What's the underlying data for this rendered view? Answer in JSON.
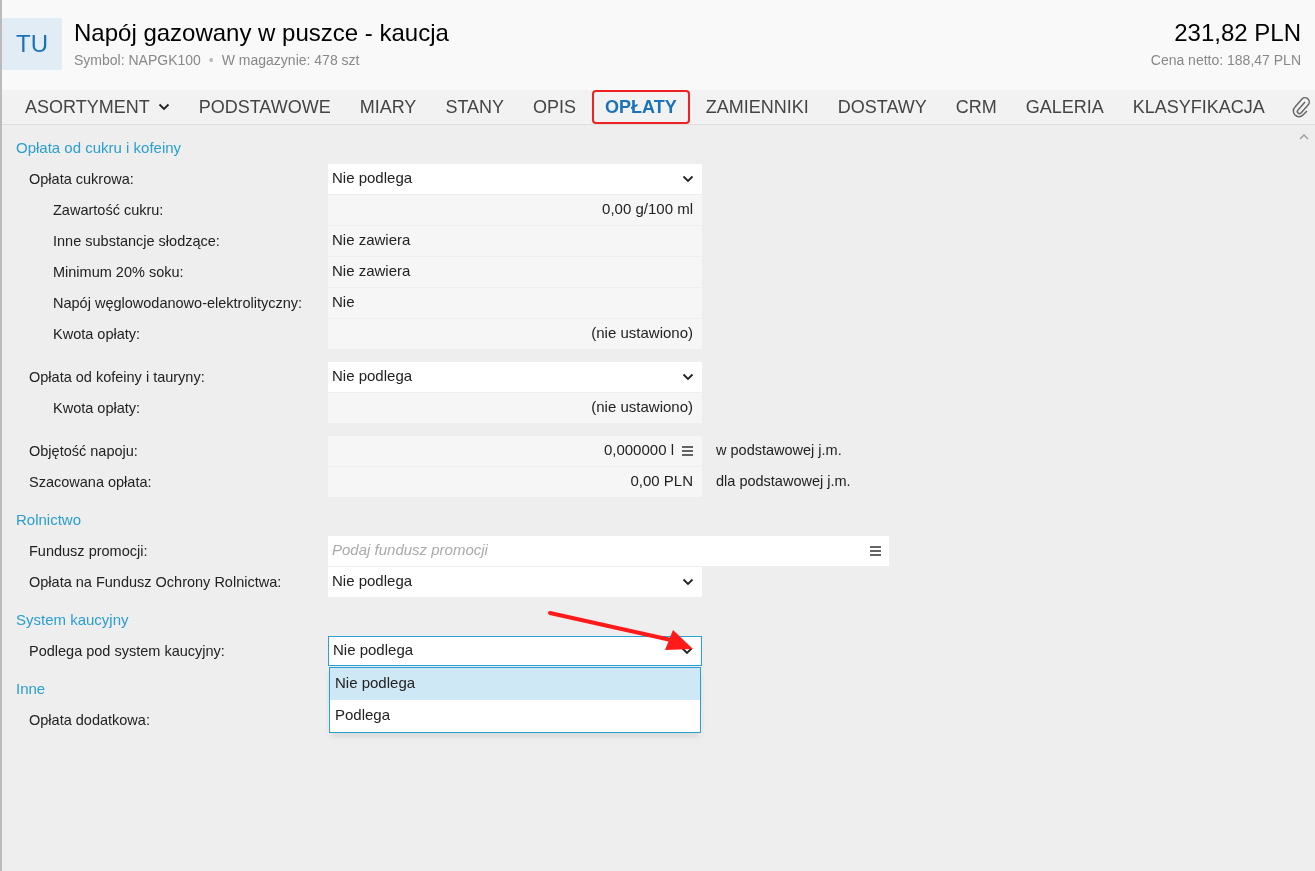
{
  "header": {
    "avatar": "TU",
    "title": "Napój gazowany w puszce - kaucja",
    "symbol": "Symbol: NAPGK100",
    "separator": "•",
    "stock": "W magazynie: 478 szt",
    "price": "231,82 PLN",
    "net_price": "Cena netto: 188,47 PLN"
  },
  "tabs": [
    {
      "label": "ASORTYMENT",
      "selected": false,
      "dropdown": true,
      "highlighted": false
    },
    {
      "label": "PODSTAWOWE",
      "selected": false,
      "dropdown": false,
      "highlighted": false
    },
    {
      "label": "MIARY",
      "selected": false,
      "dropdown": false,
      "highlighted": false
    },
    {
      "label": "STANY",
      "selected": false,
      "dropdown": false,
      "highlighted": false
    },
    {
      "label": "OPIS",
      "selected": false,
      "dropdown": false,
      "highlighted": false
    },
    {
      "label": "OPŁATY",
      "selected": true,
      "dropdown": false,
      "highlighted": true
    },
    {
      "label": "ZAMIENNIKI",
      "selected": false,
      "dropdown": false,
      "highlighted": false
    },
    {
      "label": "DOSTAWY",
      "selected": false,
      "dropdown": false,
      "highlighted": false
    },
    {
      "label": "CRM",
      "selected": false,
      "dropdown": false,
      "highlighted": false
    },
    {
      "label": "GALERIA",
      "selected": false,
      "dropdown": false,
      "highlighted": false
    },
    {
      "label": "KLASYFIKACJA",
      "selected": false,
      "dropdown": false,
      "highlighted": false
    }
  ],
  "sections": [
    {
      "title": "Opłata od cukru i kofeiny",
      "rows": [
        {
          "label": "Opłata cukrowa:",
          "kind": "select",
          "value": "Nie podlega",
          "children": [
            {
              "label": "Zawartość cukru:",
              "kind": "readonly",
              "right_aligned": true,
              "value": "0,00 g/100 ml"
            },
            {
              "label": "Inne substancje słodzące:",
              "kind": "readonly",
              "right_aligned": false,
              "value": "Nie zawiera"
            },
            {
              "label": "Minimum 20% soku:",
              "kind": "readonly",
              "right_aligned": false,
              "value": "Nie zawiera"
            },
            {
              "label": "Napój węglowodanowo-elektrolityczny:",
              "kind": "readonly",
              "right_aligned": false,
              "value": "Nie"
            },
            {
              "label": "Kwota opłaty:",
              "kind": "readonly",
              "right_aligned": true,
              "value": "(nie ustawiono)"
            }
          ]
        },
        {
          "label": "Opłata od kofeiny i tauryny:",
          "kind": "select",
          "value": "Nie podlega",
          "children": [
            {
              "label": "Kwota opłaty:",
              "kind": "readonly",
              "right_aligned": true,
              "value": "(nie ustawiono)"
            }
          ]
        },
        {
          "label": "Objętość napoju:",
          "kind": "readonly",
          "right_aligned": true,
          "value": "0,000000 l",
          "menu": true,
          "suffix": "w podstawowej j.m."
        },
        {
          "label": "Szacowana opłata:",
          "kind": "readonly",
          "right_aligned": true,
          "value": "0,00 PLN",
          "suffix": "dla podstawowej j.m."
        }
      ]
    },
    {
      "title": "Rolnictwo",
      "rows": [
        {
          "label": "Fundusz promocji:",
          "kind": "lookup",
          "placeholder": "Podaj fundusz promocji",
          "menu": true
        },
        {
          "label": "Opłata na Fundusz Ochrony Rolnictwa:",
          "kind": "select",
          "value": "Nie podlega"
        }
      ]
    },
    {
      "title": "System kaucyjny",
      "rows": [
        {
          "label": "Podlega pod system kaucyjny:",
          "kind": "select",
          "value": "Nie podlega",
          "open": true,
          "arrow": true,
          "options": [
            {
              "label": "Nie podlega",
              "selected": true
            },
            {
              "label": "Podlega",
              "selected": false
            }
          ]
        }
      ]
    },
    {
      "title": "Inne",
      "rows": [
        {
          "label": "Opłata dodatkowa:",
          "kind": "readonly"
        }
      ]
    }
  ]
}
